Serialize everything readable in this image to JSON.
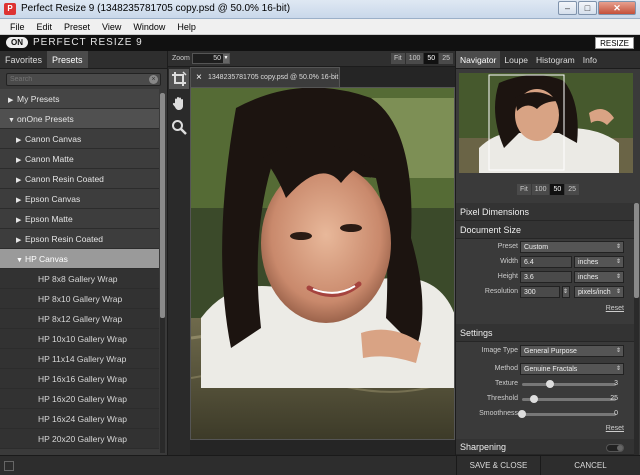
{
  "window": {
    "title": "Perfect Resize 9 (1348235781705 copy.psd @ 50.0% 16-bit)",
    "controls": [
      "–",
      "□",
      "✕"
    ]
  },
  "menu": [
    "File",
    "Edit",
    "Preset",
    "View",
    "Window",
    "Help"
  ],
  "app": {
    "logo_mark": "ON",
    "logo_text": "PERFECT RESIZE 9",
    "mode": "RESIZE"
  },
  "left_panel": {
    "tabs": [
      "Favorites",
      "Presets"
    ],
    "active_tab": "Presets",
    "search_placeholder": "Search",
    "items": [
      {
        "label": "My Presets",
        "kind": "top",
        "expanded": false
      },
      {
        "label": "onOne Presets",
        "kind": "top",
        "expanded": true
      },
      {
        "label": "Canon Canvas",
        "kind": "sub",
        "expanded": false
      },
      {
        "label": "Canon Matte",
        "kind": "sub",
        "expanded": false
      },
      {
        "label": "Canon Resin Coated",
        "kind": "sub",
        "expanded": false
      },
      {
        "label": "Epson Canvas",
        "kind": "sub",
        "expanded": false
      },
      {
        "label": "Epson Matte",
        "kind": "sub",
        "expanded": false
      },
      {
        "label": "Epson Resin Coated",
        "kind": "sub",
        "expanded": false
      },
      {
        "label": "HP Canvas",
        "kind": "sub",
        "expanded": true,
        "selected": true
      },
      {
        "label": "HP 8x8 Gallery Wrap",
        "kind": "leaf"
      },
      {
        "label": "HP 8x10 Gallery Wrap",
        "kind": "leaf"
      },
      {
        "label": "HP 8x12 Gallery Wrap",
        "kind": "leaf"
      },
      {
        "label": "HP 10x10 Gallery Wrap",
        "kind": "leaf"
      },
      {
        "label": "HP 11x14 Gallery Wrap",
        "kind": "leaf"
      },
      {
        "label": "HP 16x16 Gallery Wrap",
        "kind": "leaf"
      },
      {
        "label": "HP 16x20 Gallery Wrap",
        "kind": "leaf"
      },
      {
        "label": "HP 16x24 Gallery Wrap",
        "kind": "leaf"
      },
      {
        "label": "HP 20x20 Gallery Wrap",
        "kind": "leaf"
      }
    ]
  },
  "center": {
    "zoom_label": "Zoom",
    "zoom_value": "50",
    "zoom_buttons": [
      "Fit",
      "100",
      "50",
      "25"
    ],
    "zoom_active": "50",
    "document_tab": "1348235781705 copy.psd @ 50.0% 16-bit",
    "close_glyph": "×"
  },
  "right_panel": {
    "tabs": [
      "Navigator",
      "Loupe",
      "Histogram",
      "Info"
    ],
    "active_tab": "Navigator",
    "nav_zoom_buttons": [
      "Fit",
      "100",
      "50",
      "25"
    ],
    "nav_zoom_active": "50",
    "pixel_dimensions_title": "Pixel Dimensions",
    "document_size": {
      "title": "Document Size",
      "preset_label": "Preset",
      "preset_value": "Custom",
      "width_label": "Width",
      "width_value": "6.4",
      "width_unit": "inches",
      "height_label": "Height",
      "height_value": "3.6",
      "height_unit": "inches",
      "resolution_label": "Resolution",
      "resolution_value": "300",
      "resolution_unit": "pixels/inch",
      "reset": "Reset"
    },
    "settings": {
      "title": "Settings",
      "image_type_label": "Image Type",
      "image_type_value": "General Purpose",
      "method_label": "Method",
      "method_value": "Genuine Fractals",
      "texture_label": "Texture",
      "texture_value": "3",
      "texture_fraction": 0.3,
      "threshold_label": "Threshold",
      "threshold_value": "25",
      "threshold_fraction": 0.125,
      "smoothness_label": "Smoothness",
      "smoothness_value": "0",
      "smoothness_fraction": 0.0,
      "reset": "Reset"
    },
    "sharpening_title": "Sharpening"
  },
  "bottom": {
    "save_label": "SAVE & CLOSE",
    "cancel_label": "CANCEL"
  }
}
